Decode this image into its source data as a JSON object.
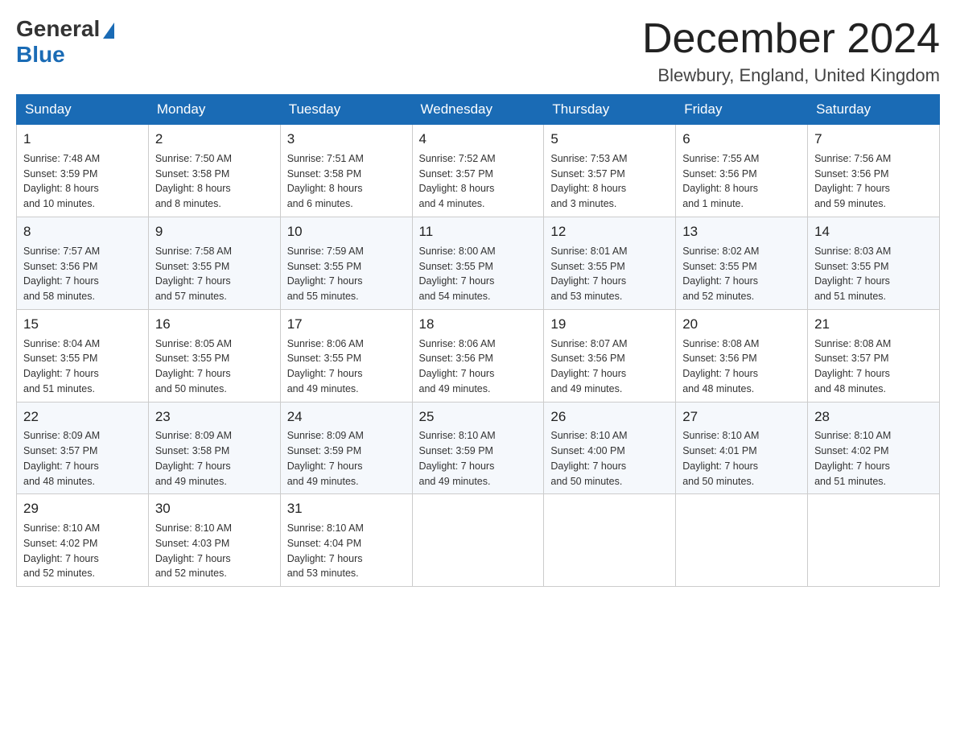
{
  "logo": {
    "general": "General",
    "blue": "Blue"
  },
  "title": "December 2024",
  "location": "Blewbury, England, United Kingdom",
  "headers": [
    "Sunday",
    "Monday",
    "Tuesday",
    "Wednesday",
    "Thursday",
    "Friday",
    "Saturday"
  ],
  "weeks": [
    [
      {
        "day": "1",
        "sunrise": "Sunrise: 7:48 AM",
        "sunset": "Sunset: 3:59 PM",
        "daylight": "Daylight: 8 hours",
        "daylight2": "and 10 minutes."
      },
      {
        "day": "2",
        "sunrise": "Sunrise: 7:50 AM",
        "sunset": "Sunset: 3:58 PM",
        "daylight": "Daylight: 8 hours",
        "daylight2": "and 8 minutes."
      },
      {
        "day": "3",
        "sunrise": "Sunrise: 7:51 AM",
        "sunset": "Sunset: 3:58 PM",
        "daylight": "Daylight: 8 hours",
        "daylight2": "and 6 minutes."
      },
      {
        "day": "4",
        "sunrise": "Sunrise: 7:52 AM",
        "sunset": "Sunset: 3:57 PM",
        "daylight": "Daylight: 8 hours",
        "daylight2": "and 4 minutes."
      },
      {
        "day": "5",
        "sunrise": "Sunrise: 7:53 AM",
        "sunset": "Sunset: 3:57 PM",
        "daylight": "Daylight: 8 hours",
        "daylight2": "and 3 minutes."
      },
      {
        "day": "6",
        "sunrise": "Sunrise: 7:55 AM",
        "sunset": "Sunset: 3:56 PM",
        "daylight": "Daylight: 8 hours",
        "daylight2": "and 1 minute."
      },
      {
        "day": "7",
        "sunrise": "Sunrise: 7:56 AM",
        "sunset": "Sunset: 3:56 PM",
        "daylight": "Daylight: 7 hours",
        "daylight2": "and 59 minutes."
      }
    ],
    [
      {
        "day": "8",
        "sunrise": "Sunrise: 7:57 AM",
        "sunset": "Sunset: 3:56 PM",
        "daylight": "Daylight: 7 hours",
        "daylight2": "and 58 minutes."
      },
      {
        "day": "9",
        "sunrise": "Sunrise: 7:58 AM",
        "sunset": "Sunset: 3:55 PM",
        "daylight": "Daylight: 7 hours",
        "daylight2": "and 57 minutes."
      },
      {
        "day": "10",
        "sunrise": "Sunrise: 7:59 AM",
        "sunset": "Sunset: 3:55 PM",
        "daylight": "Daylight: 7 hours",
        "daylight2": "and 55 minutes."
      },
      {
        "day": "11",
        "sunrise": "Sunrise: 8:00 AM",
        "sunset": "Sunset: 3:55 PM",
        "daylight": "Daylight: 7 hours",
        "daylight2": "and 54 minutes."
      },
      {
        "day": "12",
        "sunrise": "Sunrise: 8:01 AM",
        "sunset": "Sunset: 3:55 PM",
        "daylight": "Daylight: 7 hours",
        "daylight2": "and 53 minutes."
      },
      {
        "day": "13",
        "sunrise": "Sunrise: 8:02 AM",
        "sunset": "Sunset: 3:55 PM",
        "daylight": "Daylight: 7 hours",
        "daylight2": "and 52 minutes."
      },
      {
        "day": "14",
        "sunrise": "Sunrise: 8:03 AM",
        "sunset": "Sunset: 3:55 PM",
        "daylight": "Daylight: 7 hours",
        "daylight2": "and 51 minutes."
      }
    ],
    [
      {
        "day": "15",
        "sunrise": "Sunrise: 8:04 AM",
        "sunset": "Sunset: 3:55 PM",
        "daylight": "Daylight: 7 hours",
        "daylight2": "and 51 minutes."
      },
      {
        "day": "16",
        "sunrise": "Sunrise: 8:05 AM",
        "sunset": "Sunset: 3:55 PM",
        "daylight": "Daylight: 7 hours",
        "daylight2": "and 50 minutes."
      },
      {
        "day": "17",
        "sunrise": "Sunrise: 8:06 AM",
        "sunset": "Sunset: 3:55 PM",
        "daylight": "Daylight: 7 hours",
        "daylight2": "and 49 minutes."
      },
      {
        "day": "18",
        "sunrise": "Sunrise: 8:06 AM",
        "sunset": "Sunset: 3:56 PM",
        "daylight": "Daylight: 7 hours",
        "daylight2": "and 49 minutes."
      },
      {
        "day": "19",
        "sunrise": "Sunrise: 8:07 AM",
        "sunset": "Sunset: 3:56 PM",
        "daylight": "Daylight: 7 hours",
        "daylight2": "and 49 minutes."
      },
      {
        "day": "20",
        "sunrise": "Sunrise: 8:08 AM",
        "sunset": "Sunset: 3:56 PM",
        "daylight": "Daylight: 7 hours",
        "daylight2": "and 48 minutes."
      },
      {
        "day": "21",
        "sunrise": "Sunrise: 8:08 AM",
        "sunset": "Sunset: 3:57 PM",
        "daylight": "Daylight: 7 hours",
        "daylight2": "and 48 minutes."
      }
    ],
    [
      {
        "day": "22",
        "sunrise": "Sunrise: 8:09 AM",
        "sunset": "Sunset: 3:57 PM",
        "daylight": "Daylight: 7 hours",
        "daylight2": "and 48 minutes."
      },
      {
        "day": "23",
        "sunrise": "Sunrise: 8:09 AM",
        "sunset": "Sunset: 3:58 PM",
        "daylight": "Daylight: 7 hours",
        "daylight2": "and 49 minutes."
      },
      {
        "day": "24",
        "sunrise": "Sunrise: 8:09 AM",
        "sunset": "Sunset: 3:59 PM",
        "daylight": "Daylight: 7 hours",
        "daylight2": "and 49 minutes."
      },
      {
        "day": "25",
        "sunrise": "Sunrise: 8:10 AM",
        "sunset": "Sunset: 3:59 PM",
        "daylight": "Daylight: 7 hours",
        "daylight2": "and 49 minutes."
      },
      {
        "day": "26",
        "sunrise": "Sunrise: 8:10 AM",
        "sunset": "Sunset: 4:00 PM",
        "daylight": "Daylight: 7 hours",
        "daylight2": "and 50 minutes."
      },
      {
        "day": "27",
        "sunrise": "Sunrise: 8:10 AM",
        "sunset": "Sunset: 4:01 PM",
        "daylight": "Daylight: 7 hours",
        "daylight2": "and 50 minutes."
      },
      {
        "day": "28",
        "sunrise": "Sunrise: 8:10 AM",
        "sunset": "Sunset: 4:02 PM",
        "daylight": "Daylight: 7 hours",
        "daylight2": "and 51 minutes."
      }
    ],
    [
      {
        "day": "29",
        "sunrise": "Sunrise: 8:10 AM",
        "sunset": "Sunset: 4:02 PM",
        "daylight": "Daylight: 7 hours",
        "daylight2": "and 52 minutes."
      },
      {
        "day": "30",
        "sunrise": "Sunrise: 8:10 AM",
        "sunset": "Sunset: 4:03 PM",
        "daylight": "Daylight: 7 hours",
        "daylight2": "and 52 minutes."
      },
      {
        "day": "31",
        "sunrise": "Sunrise: 8:10 AM",
        "sunset": "Sunset: 4:04 PM",
        "daylight": "Daylight: 7 hours",
        "daylight2": "and 53 minutes."
      },
      null,
      null,
      null,
      null
    ]
  ]
}
